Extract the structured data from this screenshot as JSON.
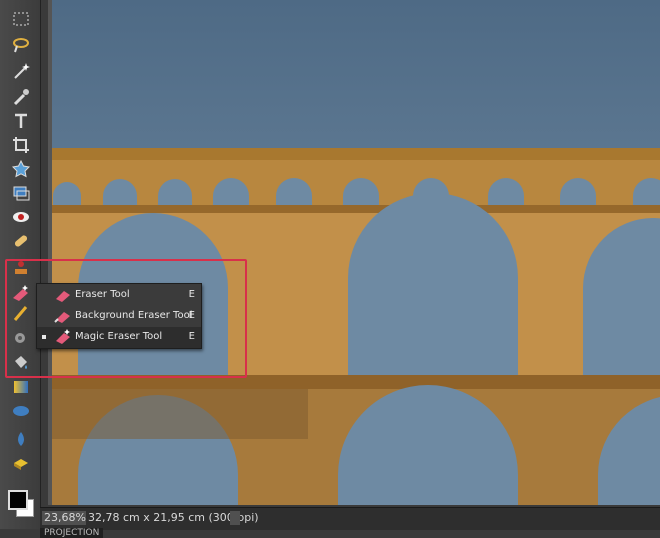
{
  "status": {
    "zoom": "23,68%",
    "dimensions": "32,78 cm x 21,95 cm (300 ppi)",
    "bin_label": "PROJECTION"
  },
  "eraser_menu": {
    "items": [
      {
        "label": "Eraser Tool",
        "key": "E"
      },
      {
        "label": "Background Eraser Tool",
        "key": "E"
      },
      {
        "label": "Magic Eraser Tool",
        "key": "E"
      }
    ]
  },
  "colors": {
    "highlight": "#d8304a",
    "sky": "#6e8aa3",
    "stone": "#b98a47"
  },
  "tools": [
    "marquee-icon",
    "lasso-icon",
    "magic-wand-icon",
    "quick-selection-icon",
    "type-icon",
    "crop-icon",
    "cookie-cutter-icon",
    "straighten-icon",
    "red-eye-icon",
    "healing-brush-icon",
    "clone-stamp-icon",
    "eraser-icon",
    "pencil-icon",
    "brush-icon",
    "paint-bucket-icon",
    "gradient-icon",
    "shape-icon",
    "blur-icon",
    "sponge-icon"
  ]
}
